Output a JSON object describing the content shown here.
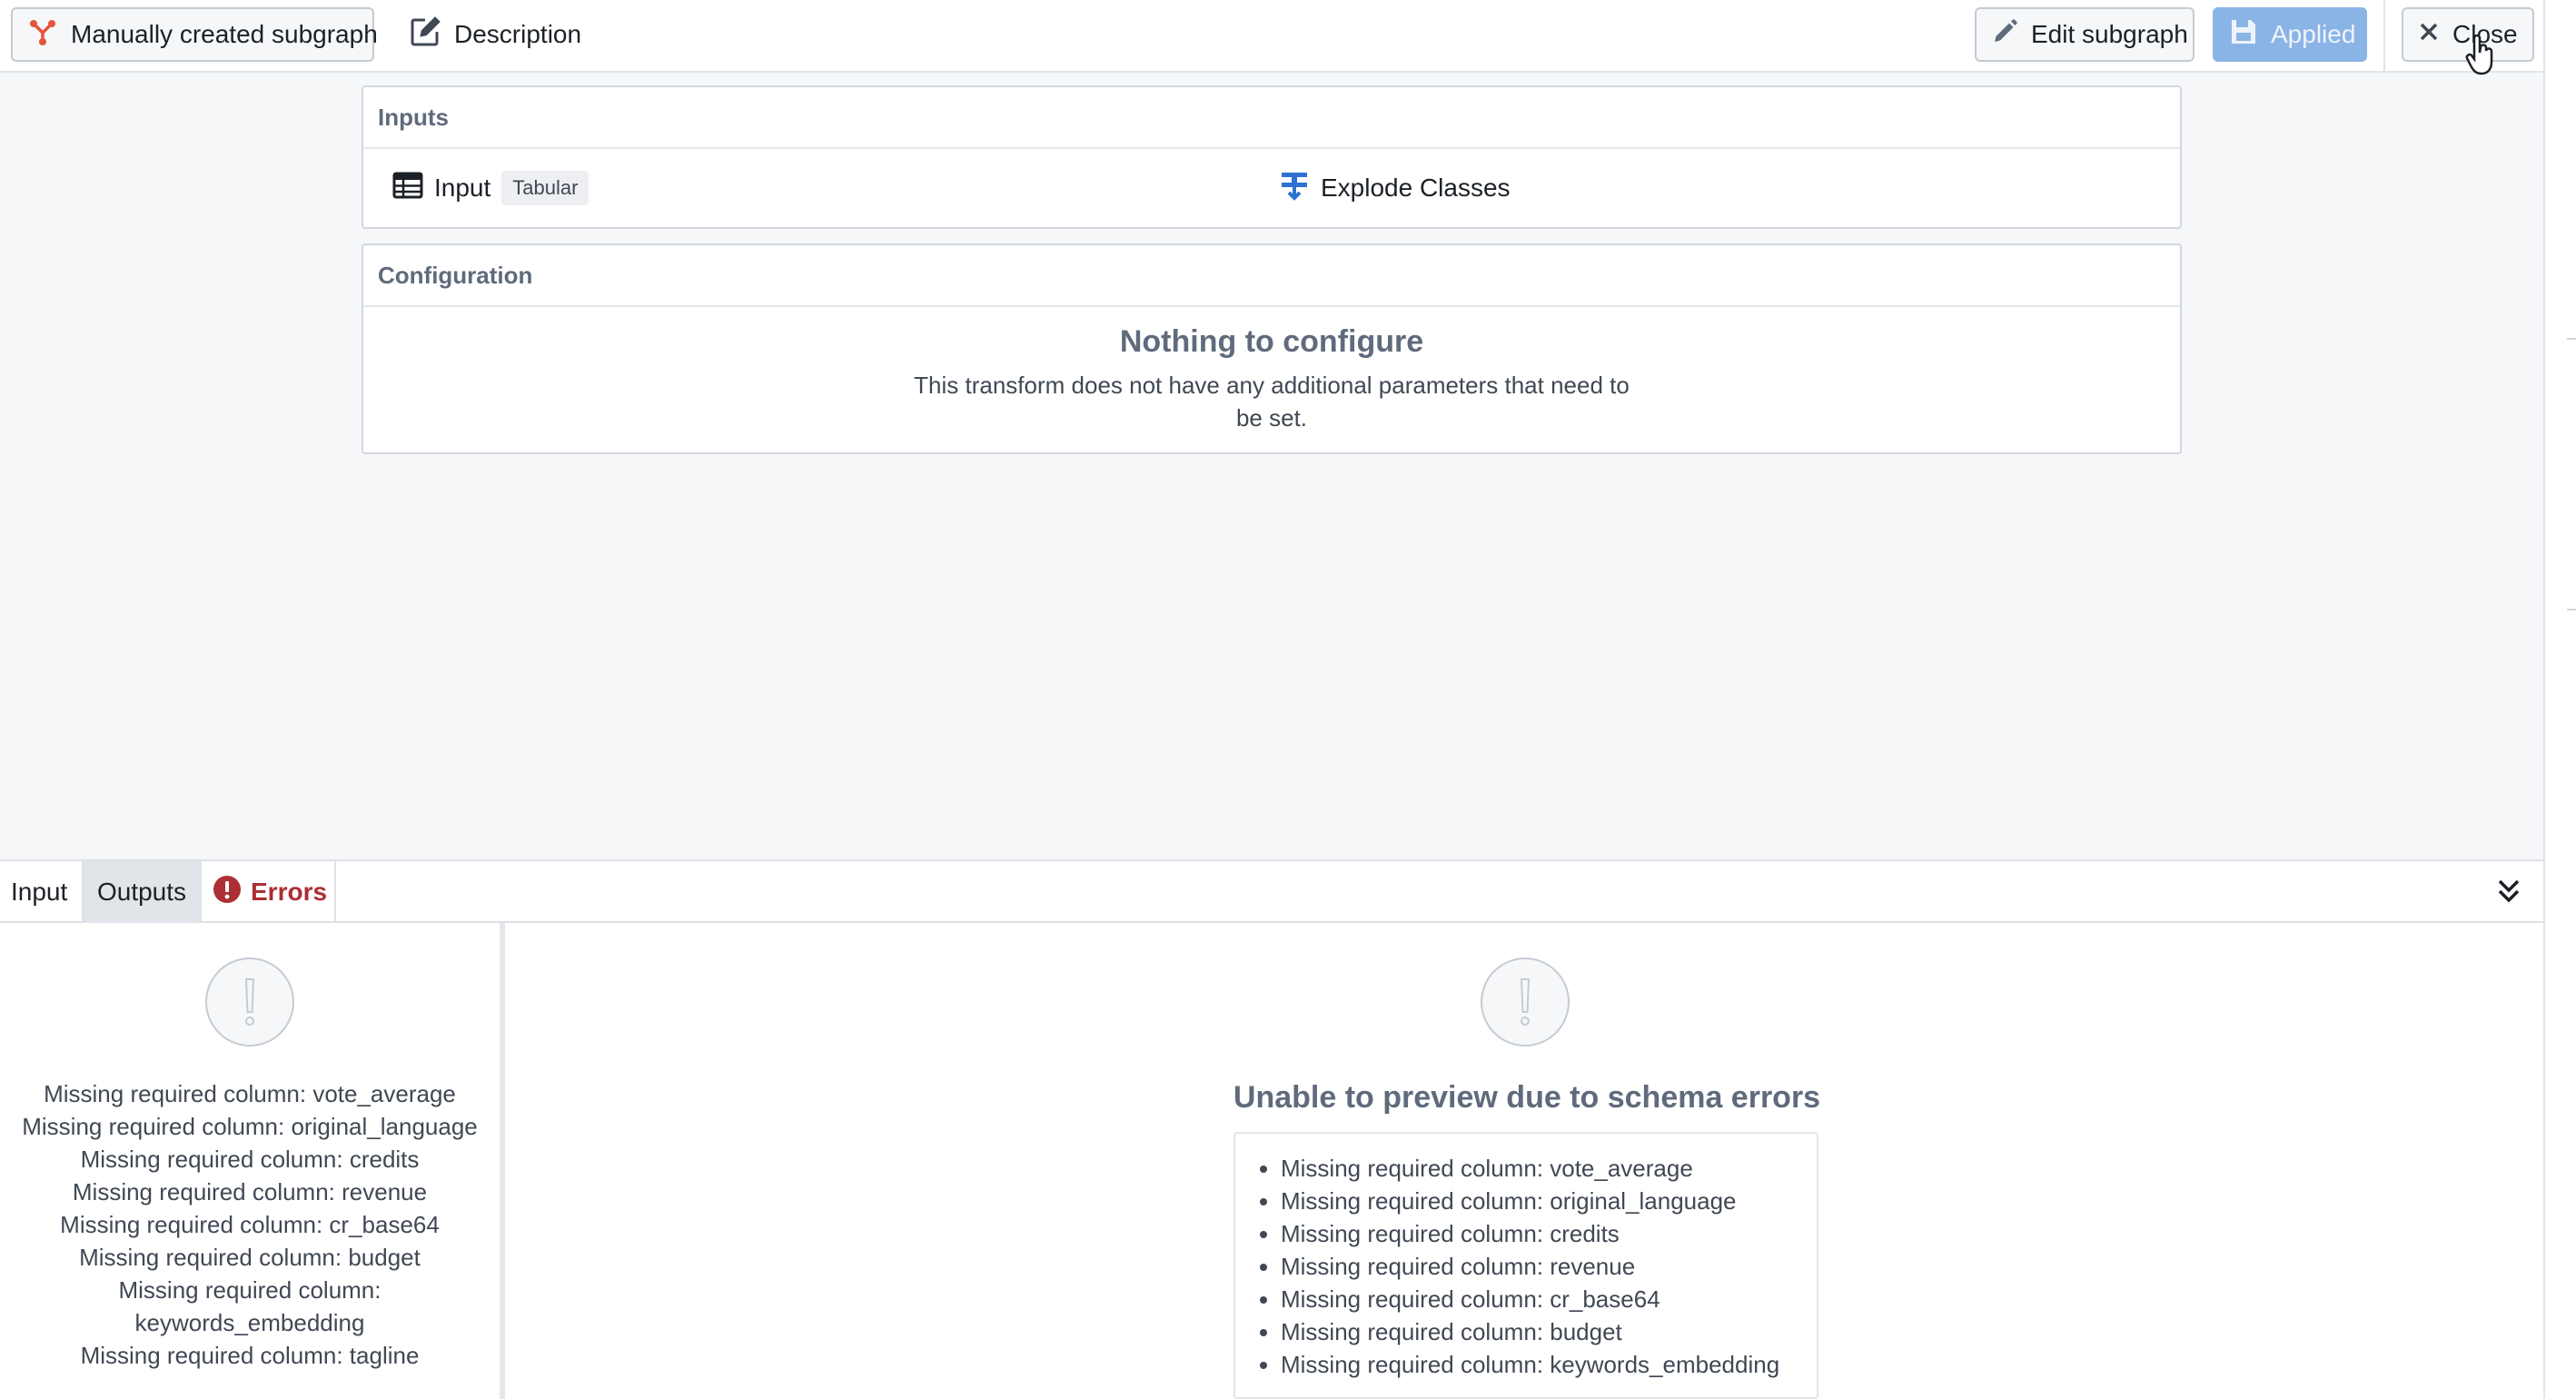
{
  "toolbar": {
    "subgraph_label": "Manually created subgraph",
    "description_label": "Description",
    "edit_label": "Edit subgraph",
    "applied_label": "Applied",
    "close_label": "Close"
  },
  "inputs_card": {
    "header": "Inputs",
    "input_name": "Input",
    "input_tag": "Tabular",
    "transform_name": "Explode Classes"
  },
  "config_card": {
    "header": "Configuration",
    "title": "Nothing to configure",
    "description": "This transform does not have any additional parameters that need to be set."
  },
  "bottom_tabs": {
    "input": "Input",
    "outputs": "Outputs",
    "errors": "Errors"
  },
  "left_errors": [
    "Missing required column: vote_average",
    "Missing required column: original_language",
    "Missing required column: credits",
    "Missing required column: revenue",
    "Missing required column: cr_base64",
    "Missing required column: budget",
    "Missing required column: keywords_embedding",
    "Missing required column: tagline"
  ],
  "preview": {
    "title": "Unable to preview due to schema errors",
    "errors": [
      "Missing required column: vote_average",
      "Missing required column: original_language",
      "Missing required column: credits",
      "Missing required column: revenue",
      "Missing required column: cr_base64",
      "Missing required column: budget",
      "Missing required column: keywords_embedding"
    ]
  },
  "colors": {
    "accent_blue": "#2d72d2",
    "subgraph_icon": "#e5533d",
    "error_red": "#ac2f33",
    "applied_button": "#8ab4e6"
  },
  "icons": {
    "subgraph": "subgraph-icon",
    "description": "edit-note-icon",
    "edit": "pencil-icon",
    "applied": "floppy-disk-icon",
    "close": "close-icon",
    "input": "table-icon",
    "transform": "explode-icon",
    "errors": "error-icon",
    "collapse": "double-chevron-down-icon",
    "warning": "warning-circle-icon"
  }
}
